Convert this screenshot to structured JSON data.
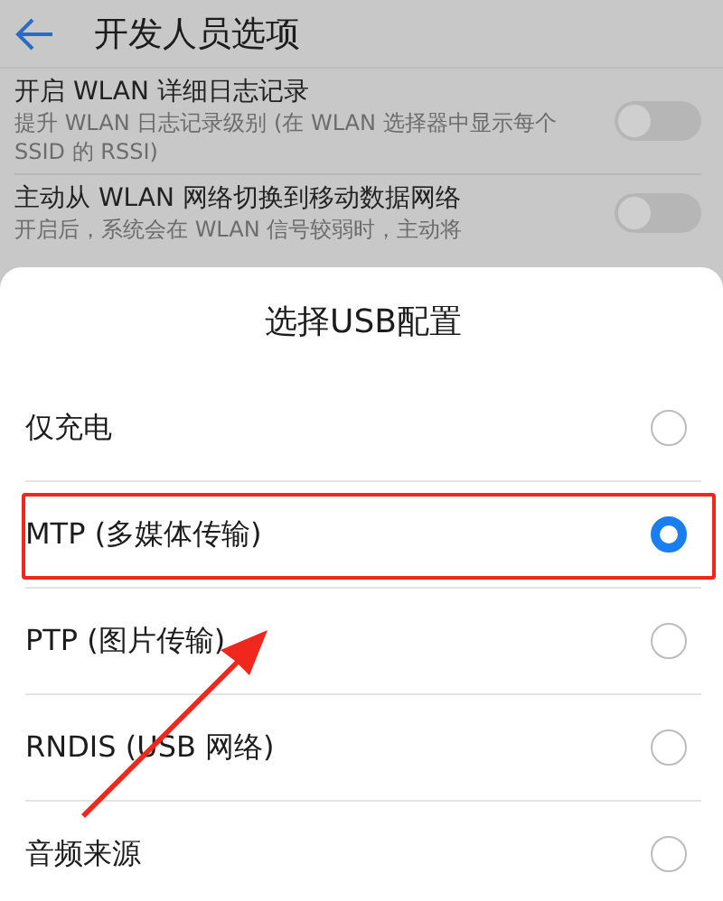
{
  "header": {
    "title": "开发人员选项"
  },
  "settings": [
    {
      "title": "开启 WLAN 详细日志记录",
      "summary": "提升 WLAN 日志记录级别 (在 WLAN 选择器中显示每个 SSID 的 RSSI)",
      "on": false
    },
    {
      "title": "主动从 WLAN 网络切换到移动数据网络",
      "summary": "开启后，系统会在 WLAN 信号较弱时，主动将",
      "on": false
    }
  ],
  "dialog": {
    "title": "选择USB配置",
    "options": [
      {
        "label": "仅充电",
        "selected": false
      },
      {
        "label": "MTP (多媒体传输)",
        "selected": true
      },
      {
        "label": "PTP (图片传输)",
        "selected": false
      },
      {
        "label": "RNDIS (USB 网络)",
        "selected": false
      },
      {
        "label": "音频来源",
        "selected": false
      }
    ]
  }
}
